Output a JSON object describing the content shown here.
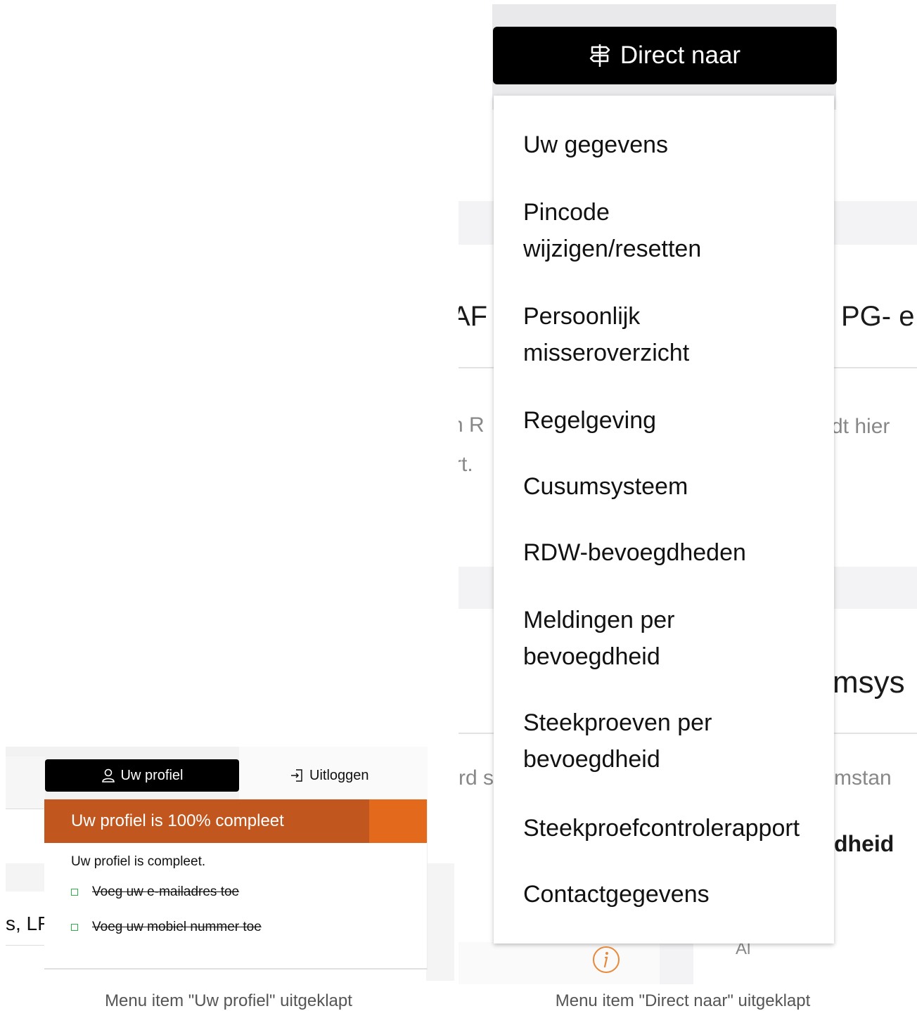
{
  "right": {
    "direct_button_label": "Direct naar",
    "menu_items": [
      "Uw gegevens",
      "Pincode\nwijzigen/resetten",
      "Persoonlijk\nmisseroverzicht",
      "Regelgeving",
      "Cusumsysteem",
      "RDW-bevoegdheden",
      "Meldingen per\nbevoegdheid",
      "Steekproeven per\nbevoegdheid",
      "Steekproefcontrolerapport",
      "Contactgegevens"
    ],
    "background_fragments": {
      "heading_left": "AF",
      "heading_right": "PG- e",
      "text_left_1": "n R",
      "text_left_2": "rt.",
      "text_right_1": "dt hier",
      "heading2_right": "msys",
      "text_left_3": "rd s",
      "text_right_3": "mstan",
      "bold_right": "dheid",
      "small_bottom": "Al"
    }
  },
  "left": {
    "profile_button_label": "Uw profiel",
    "logout_label": "Uitloggen",
    "progress_label": "Uw profiel is 100% compleet",
    "progress_fraction": 0.85,
    "complete_text": "Uw profiel is compleet.",
    "todos": [
      "Voeg uw e-mailadres toe",
      "Voeg uw mobiel nummer toe"
    ],
    "background_fragment": "s, LF"
  },
  "captions": {
    "left": "Menu item \"Uw profiel\" uitgeklapt",
    "right": "Menu item \"Direct naar\" uitgeklapt"
  },
  "colors": {
    "button_black": "#000000",
    "progress_orange": "#e36a1d",
    "progress_dark": "#c1561f",
    "check_green": "#2fb24a",
    "info_orange": "#e8893a"
  }
}
